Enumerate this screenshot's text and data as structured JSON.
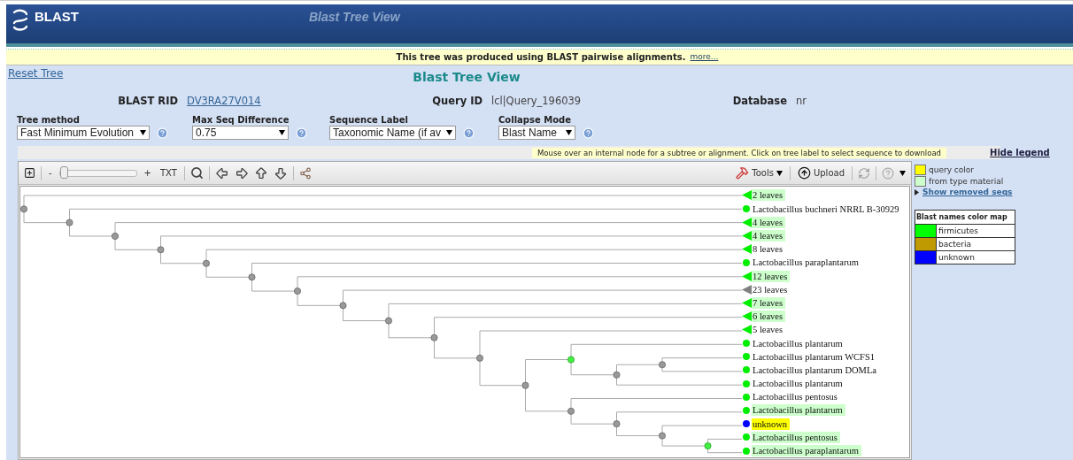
{
  "header": {
    "logo": "BLAST",
    "title": "Blast Tree View"
  },
  "banner": {
    "text": "This tree was produced using BLAST pairwise alignments.",
    "link": "more..."
  },
  "reset_link": "Reset Tree",
  "page_title": "Blast Tree View",
  "info": [
    {
      "label": "BLAST RID",
      "value": "DV3RA27V014",
      "kind": "link"
    },
    {
      "label": "Query ID",
      "value": "lcl|Query_196039",
      "kind": "text"
    },
    {
      "label": "Database",
      "value": "nr",
      "kind": "text"
    }
  ],
  "options": [
    {
      "label": "Tree method",
      "value": "Fast Minimum Evolution"
    },
    {
      "label": "Max Seq Difference",
      "value": "0.75"
    },
    {
      "label": "Sequence Label",
      "value": "Taxonomic Name (if av"
    },
    {
      "label": "Collapse Mode",
      "value": "Blast Name"
    }
  ],
  "hint": "Mouse over an internal node for a subtree or alignment. Click on tree label to select sequence to download",
  "hide_legend": "Hide legend",
  "toolbar": {
    "zoom_out": "-",
    "zoom": {
      "level": 0
    },
    "zoom_in": "+",
    "txt": "TXT",
    "tools": "Tools",
    "upload": "Upload"
  },
  "legend": {
    "items": [
      {
        "label": "query color",
        "color": "#ffff00"
      },
      {
        "label": "from type material",
        "color": "#ccffcc"
      }
    ],
    "show_removed": "Show removed seqs",
    "color_map": {
      "title": "Blast names color map",
      "rows": [
        {
          "name": "firmicutes",
          "color": "#00ff00"
        },
        {
          "name": "bacteria",
          "color": "#bf9a00"
        },
        {
          "name": "unknown",
          "color": "#0000ff"
        }
      ]
    }
  },
  "leaves": [
    {
      "label": "2 leaves",
      "kind": "collapsed",
      "color": "#00ee00",
      "type_material": true,
      "query": false
    },
    {
      "label": "Lactobacillus buchneri NRRL B-30929",
      "kind": "leaf",
      "color": "#00ee00",
      "type_material": false,
      "query": false
    },
    {
      "label": "4 leaves",
      "kind": "collapsed",
      "color": "#00ee00",
      "type_material": true,
      "query": false
    },
    {
      "label": "4 leaves",
      "kind": "collapsed",
      "color": "#00ee00",
      "type_material": true,
      "query": false
    },
    {
      "label": "8 leaves",
      "kind": "collapsed",
      "color": "#00ee00",
      "type_material": false,
      "query": false
    },
    {
      "label": "Lactobacillus paraplantarum",
      "kind": "leaf",
      "color": "#00ee00",
      "type_material": false,
      "query": false
    },
    {
      "label": "12 leaves",
      "kind": "collapsed",
      "color": "#00ee00",
      "type_material": true,
      "query": false
    },
    {
      "label": "23 leaves",
      "kind": "collapsed",
      "color": "#808080",
      "type_material": false,
      "query": false
    },
    {
      "label": "7 leaves",
      "kind": "collapsed",
      "color": "#00ee00",
      "type_material": true,
      "query": false
    },
    {
      "label": "6 leaves",
      "kind": "collapsed",
      "color": "#00ee00",
      "type_material": true,
      "query": false
    },
    {
      "label": "5 leaves",
      "kind": "collapsed",
      "color": "#00ee00",
      "type_material": false,
      "query": false
    },
    {
      "label": "Lactobacillus plantarum",
      "kind": "leaf",
      "color": "#00ee00",
      "type_material": false,
      "query": false
    },
    {
      "label": "Lactobacillus plantarum WCFS1",
      "kind": "leaf",
      "color": "#00ee00",
      "type_material": false,
      "query": false
    },
    {
      "label": "Lactobacillus plantarum DOMLa",
      "kind": "leaf",
      "color": "#00ee00",
      "type_material": false,
      "query": false
    },
    {
      "label": "Lactobacillus plantarum",
      "kind": "leaf",
      "color": "#00ee00",
      "type_material": false,
      "query": false
    },
    {
      "label": "Lactobacillus pentosus",
      "kind": "leaf",
      "color": "#00ee00",
      "type_material": false,
      "query": false
    },
    {
      "label": "Lactobacillus plantarum",
      "kind": "leaf",
      "color": "#00ee00",
      "type_material": true,
      "query": false
    },
    {
      "label": "unknown",
      "kind": "leaf",
      "color": "#0000ff",
      "query": true
    },
    {
      "label": "Lactobacillus pentosus",
      "kind": "leaf",
      "color": "#00ee00",
      "type_material": true,
      "query": false
    },
    {
      "label": "Lactobacillus paraplantarum",
      "kind": "leaf",
      "color": "#00ee00",
      "type_material": true,
      "query": false
    }
  ]
}
